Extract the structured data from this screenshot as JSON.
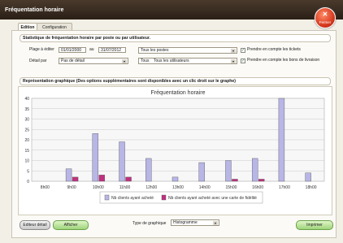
{
  "window": {
    "title": "Fréquentation horaire",
    "close_label": "Fermer"
  },
  "tabs": [
    {
      "label": "Edition"
    },
    {
      "label": "Configuration"
    }
  ],
  "section_stats": "Statistique de fréquentation horaire par poste ou par utilisateur.",
  "period": {
    "label": "Plage à éditer",
    "from": "01/01/2000",
    "to_label": "au",
    "to": "31/07/2012"
  },
  "poste": {
    "value": "Tous les postes"
  },
  "detail": {
    "label": "Détail par",
    "value": "Pas de détail"
  },
  "users": {
    "left": "Tous",
    "right": "Tous les utilisateurs"
  },
  "checkboxes": [
    {
      "label": "Prendre en compte les tickets",
      "checked": true
    },
    {
      "label": "Prendre en compte les bons de livraison",
      "checked": true
    }
  ],
  "section_graph": "Représentation graphique (Des options supplémentaires sont disponibles avec un clic droit sur le graphe)",
  "chart_data": {
    "type": "bar",
    "title": "Fréquentation horaire",
    "categories": [
      "8h00",
      "9h00",
      "10h00",
      "11h00",
      "12h00",
      "13h00",
      "14h00",
      "15h00",
      "16h00",
      "17h00",
      "18h00"
    ],
    "ylim": [
      0,
      40
    ],
    "yticks": [
      0,
      5,
      10,
      15,
      20,
      25,
      30,
      35,
      40
    ],
    "grid": true,
    "legend_position": "bottom",
    "series": [
      {
        "name": "Nb clients ayant acheté",
        "color": "#b8b6e6",
        "values": [
          0,
          6,
          23,
          19,
          11,
          2,
          9,
          10,
          11,
          40,
          4
        ]
      },
      {
        "name": "Nb clients ayant acheté avec une carte de fidélité",
        "color": "#c0307f",
        "values": [
          0,
          2,
          3,
          2,
          0,
          0,
          0,
          1,
          1,
          0,
          0
        ]
      }
    ]
  },
  "footer": {
    "edit_detail_label": "Editeur détail",
    "show_label": "Afficher",
    "chart_type_label": "Type de graphique",
    "chart_type_value": "Histogramme",
    "print_label": "Imprimer"
  }
}
